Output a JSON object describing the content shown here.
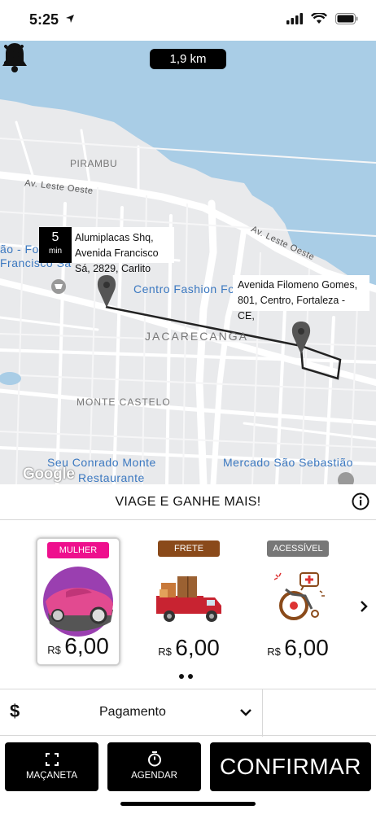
{
  "status_bar": {
    "time": "5:25"
  },
  "map": {
    "distance": "1,9 km",
    "eta": {
      "value": "5",
      "unit": "min"
    },
    "origin_address": "Alumiplacas Shq, Avenida Francisco Sá, 2829, Carlito",
    "destination_address": "Avenida Filomeno Gomes, 801, Centro, Fortaleza - CE,",
    "labels": {
      "pirambu": "PIRAMBU",
      "av_leste_oeste_1": "Av. Leste Oeste",
      "av_leste_oeste_2": "Av. Leste Oeste",
      "sao_francisco": "ão - For\nFrancisco Sá",
      "centro_fashion": "Centro Fashion Fo",
      "jacarecanga": "JACARECANGA",
      "monte_castelo": "MONTE CASTELO",
      "seu_conrado": "Seu Conrado Monte",
      "restaurante": "Restaurante",
      "mercado": "Mercado São Sebastião",
      "google": "Google"
    }
  },
  "promo": {
    "title": "VIAGE E GANHE MAIS!"
  },
  "ride_options": [
    {
      "badge": "MULHER",
      "badge_color": "#ee0f8d",
      "currency": "R$",
      "price": "6,00",
      "icon": "car-icon"
    },
    {
      "badge": "FRETE",
      "badge_color": "#8a4a1a",
      "currency": "R$",
      "price": "6,00",
      "icon": "truck-icon"
    },
    {
      "badge": "ACESSÍVEL",
      "badge_color": "#777777",
      "currency": "R$",
      "price": "6,00",
      "icon": "wheelchair-icon"
    }
  ],
  "payment": {
    "currency_symbol": "$",
    "label": "Pagamento"
  },
  "actions": {
    "macaneta": "MAÇANETA",
    "agendar": "AGENDAR",
    "confirmar": "CONFIRMAR"
  },
  "colors": {
    "water": "#a9cde6",
    "road": "#ffffff",
    "land": "#e9eaec",
    "label": "#3b78c0"
  }
}
